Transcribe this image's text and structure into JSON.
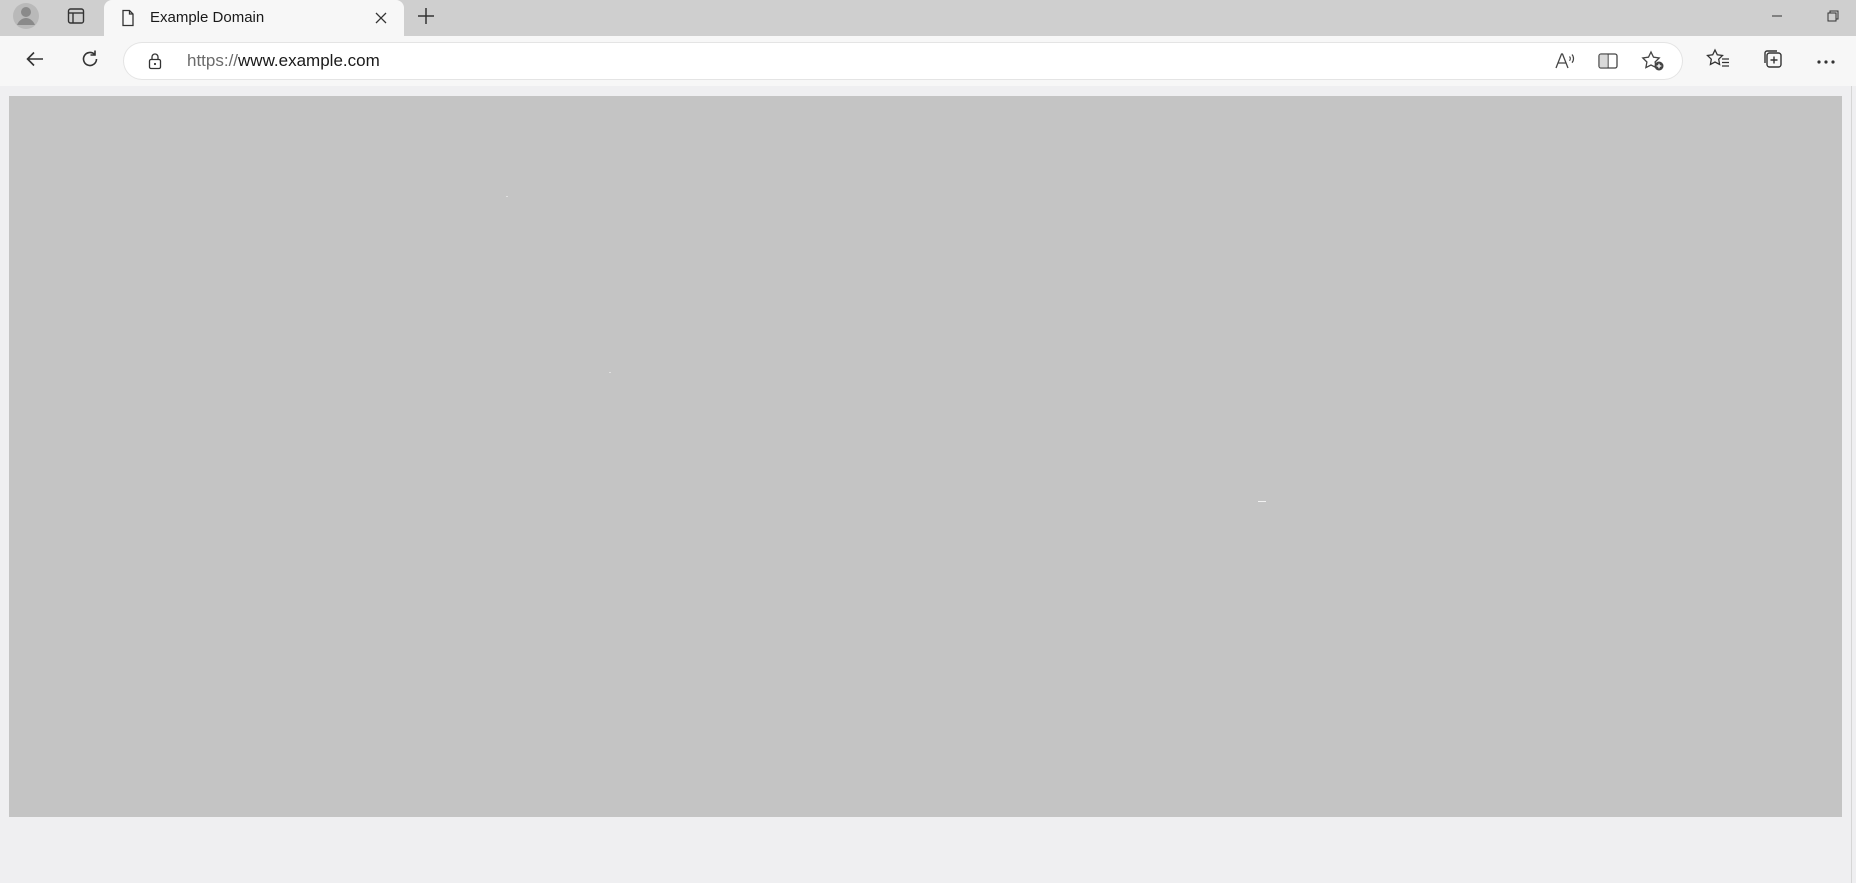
{
  "tab": {
    "title": "Example Domain"
  },
  "address_bar": {
    "url_scheme": "https://",
    "url_host": "www.example.com"
  },
  "icons": {
    "profile": "profile-avatar-icon",
    "tab_actions": "tab-actions-icon",
    "favicon": "page-document-icon",
    "close_tab": "close-icon",
    "new_tab": "plus-icon",
    "minimize": "minimize-icon",
    "restore": "restore-icon",
    "back": "back-arrow-icon",
    "refresh": "refresh-icon",
    "lock": "lock-icon",
    "read_aloud": "read-aloud-icon",
    "split_screen": "split-screen-icon",
    "add_favorite": "add-favorite-icon",
    "favorites": "favorites-icon",
    "collections": "collections-icon",
    "more": "more-icon"
  },
  "colors": {
    "tabstrip_bg": "#cfcfcf",
    "toolbar_bg": "#f7f7f7",
    "page_bg": "#efeff1",
    "content_placeholder": "#c4c4c4"
  }
}
